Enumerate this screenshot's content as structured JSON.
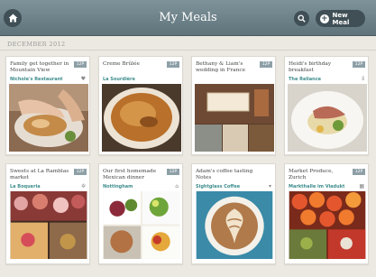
{
  "header": {
    "title": "My Meals",
    "new_button_label": "New Meal",
    "new_button_plus": "+"
  },
  "section": {
    "label": "DECEMBER 2012"
  },
  "meals": [
    {
      "title": "Family get together in Mountain View",
      "count": "12P",
      "location": "Nichole's Restaurant",
      "type_icon": "heart-icon",
      "type_glyph": "♥"
    },
    {
      "title": "Creme Brûlée",
      "count": "12P",
      "location": "La Sourdière",
      "type_icon": "",
      "type_glyph": ""
    },
    {
      "title": "Bethany & Liam's wedding in France",
      "count": "12P",
      "location": "",
      "type_icon": "",
      "type_glyph": ""
    },
    {
      "title": "Heidi's birthday breakfast",
      "count": "12P",
      "location": "The Reliance",
      "type_icon": "fork-knife-icon",
      "type_glyph": "ⅱ"
    },
    {
      "title": "Sweets at La Ramblas market",
      "count": "12P",
      "location": "La Boqueria",
      "type_icon": "star-icon",
      "type_glyph": "✲"
    },
    {
      "title": "Our first homemade Mexican dinner",
      "count": "12P",
      "location": "Nottingham",
      "type_icon": "house-icon",
      "type_glyph": "⌂"
    },
    {
      "title": "Adam's coffee tasting Notes",
      "count": "",
      "location": "Sightglass Coffee",
      "type_icon": "cup-icon",
      "type_glyph": "▾"
    },
    {
      "title": "Market Produce, Zurich",
      "count": "12P",
      "location": "Markthalle im Viadukt",
      "type_icon": "basket-icon",
      "type_glyph": "▦"
    }
  ]
}
